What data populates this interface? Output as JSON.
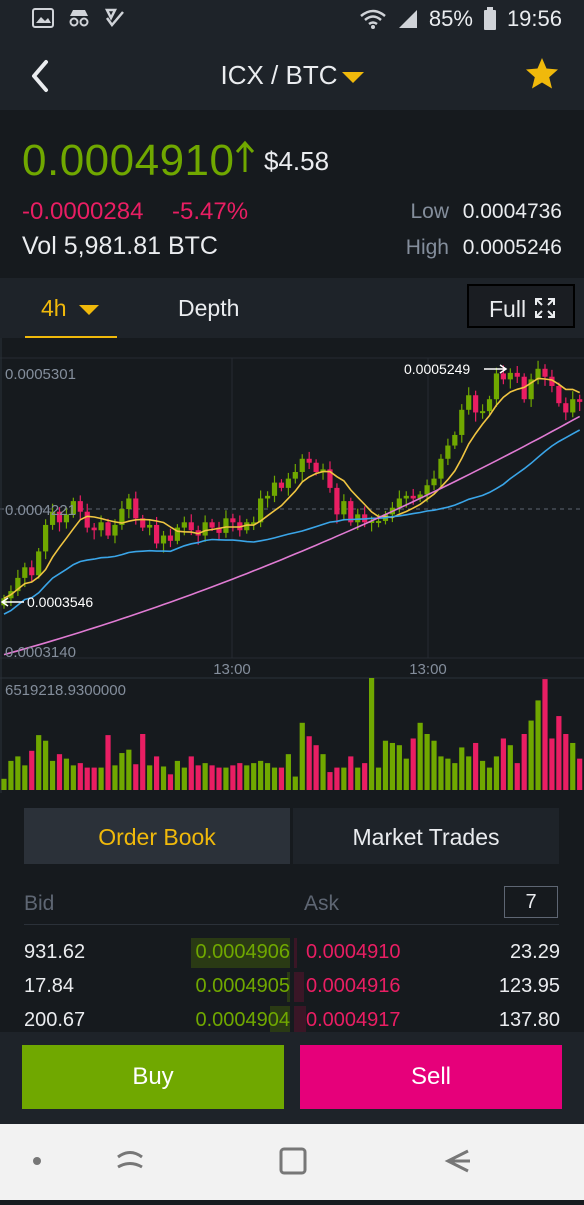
{
  "status": {
    "battery": "85%",
    "time": "19:56"
  },
  "header": {
    "pair": "ICX / BTC"
  },
  "ticker": {
    "price": "0.0004910",
    "usd": "$4.58",
    "change": "-0.0000284",
    "change_pct": "-5.47%",
    "volume": "Vol 5,981.81 BTC",
    "low_label": "Low",
    "low": "0.0004736",
    "high_label": "High",
    "high": "0.0005246"
  },
  "tabs": {
    "interval": "4h",
    "depth": "Depth",
    "full": "Full"
  },
  "chart_data": {
    "type": "candlestick",
    "price_labels": {
      "top": "0.0005301",
      "mid": "0.0004221",
      "bottom": "0.0003140",
      "max_marker": "0.0005249",
      "min_marker": "0.0003546"
    },
    "price_range": [
      0.000314,
      0.0005301
    ],
    "time_labels": [
      "13:00",
      "13:00"
    ],
    "volume_label": "6519218.9300000",
    "colors": {
      "up": "#70a800",
      "down": "#e91e63",
      "ma_short": "#f0c541",
      "ma_mid": "#3aa5e8",
      "ma_long": "#e07bd3"
    },
    "closes": [
      0.0003546,
      0.00036,
      0.00037,
      0.000378,
      0.000372,
      0.00039,
      0.00041,
      0.00042,
      0.000412,
      0.000418,
      0.000428,
      0.00042,
      0.000408,
      0.000406,
      0.000412,
      0.000402,
      0.00041,
      0.000422,
      0.00043,
      0.000415,
      0.000408,
      0.00041,
      0.000396,
      0.000402,
      0.000398,
      0.000408,
      0.000412,
      0.000406,
      0.000402,
      0.000412,
      0.000408,
      0.000404,
      0.000415,
      0.000412,
      0.000406,
      0.000412,
      0.000412,
      0.00043,
      0.000432,
      0.000442,
      0.000438,
      0.000445,
      0.00045,
      0.00046,
      0.000457,
      0.00045,
      0.000452,
      0.000438,
      0.000418,
      0.000428,
      0.000412,
      0.000418,
      0.000412,
      0.000413,
      0.000413,
      0.000418,
      0.000423,
      0.00043,
      0.000432,
      0.00043,
      0.000433,
      0.00044,
      0.000445,
      0.00046,
      0.00047,
      0.000478,
      0.000497,
      0.000508,
      0.000495,
      0.000496,
      0.000505,
      0.0005245,
      0.00052,
      0.0005249,
      0.000522,
      0.000505,
      0.00052,
      0.000528,
      0.000522,
      0.000515,
      0.000502,
      0.000495,
      0.000505,
      0.000503
    ],
    "volumes": [
      0.1,
      0.26,
      0.3,
      0.22,
      0.35,
      0.49,
      0.44,
      0.26,
      0.32,
      0.28,
      0.22,
      0.24,
      0.2,
      0.2,
      0.2,
      0.49,
      0.22,
      0.33,
      0.36,
      0.23,
      0.5,
      0.22,
      0.3,
      0.21,
      0.14,
      0.26,
      0.2,
      0.3,
      0.22,
      0.24,
      0.22,
      0.2,
      0.2,
      0.22,
      0.24,
      0.22,
      0.24,
      0.26,
      0.24,
      0.2,
      0.2,
      0.32,
      0.12,
      0.6,
      0.48,
      0.4,
      0.32,
      0.16,
      0.2,
      0.2,
      0.3,
      0.2,
      0.24,
      1.0,
      0.2,
      0.44,
      0.42,
      0.4,
      0.28,
      0.46,
      0.6,
      0.5,
      0.44,
      0.3,
      0.28,
      0.24,
      0.38,
      0.3,
      0.42,
      0.26,
      0.2,
      0.3,
      0.46,
      0.4,
      0.24,
      0.5,
      0.62,
      0.8,
      0.99,
      0.46,
      0.66,
      0.5,
      0.42,
      0.28
    ]
  },
  "orderbook": {
    "tab_orderbook": "Order Book",
    "tab_trades": "Market Trades",
    "bid_label": "Bid",
    "ask_label": "Ask",
    "depth": "7",
    "rows": [
      {
        "bid_qty": "931.62",
        "bid_price": "0.0004906",
        "ask_price": "0.0004910",
        "ask_qty": "23.29"
      },
      {
        "bid_qty": "17.84",
        "bid_price": "0.0004905",
        "ask_price": "0.0004916",
        "ask_qty": "123.95"
      },
      {
        "bid_qty": "200.67",
        "bid_price": "0.0004904",
        "ask_price": "0.0004917",
        "ask_qty": "137.80"
      }
    ],
    "depth_fill": {
      "bid": [
        0.58,
        0.02,
        0.12
      ],
      "ask": [
        0.02,
        0.06,
        0.07
      ]
    }
  },
  "actions": {
    "buy": "Buy",
    "sell": "Sell"
  }
}
